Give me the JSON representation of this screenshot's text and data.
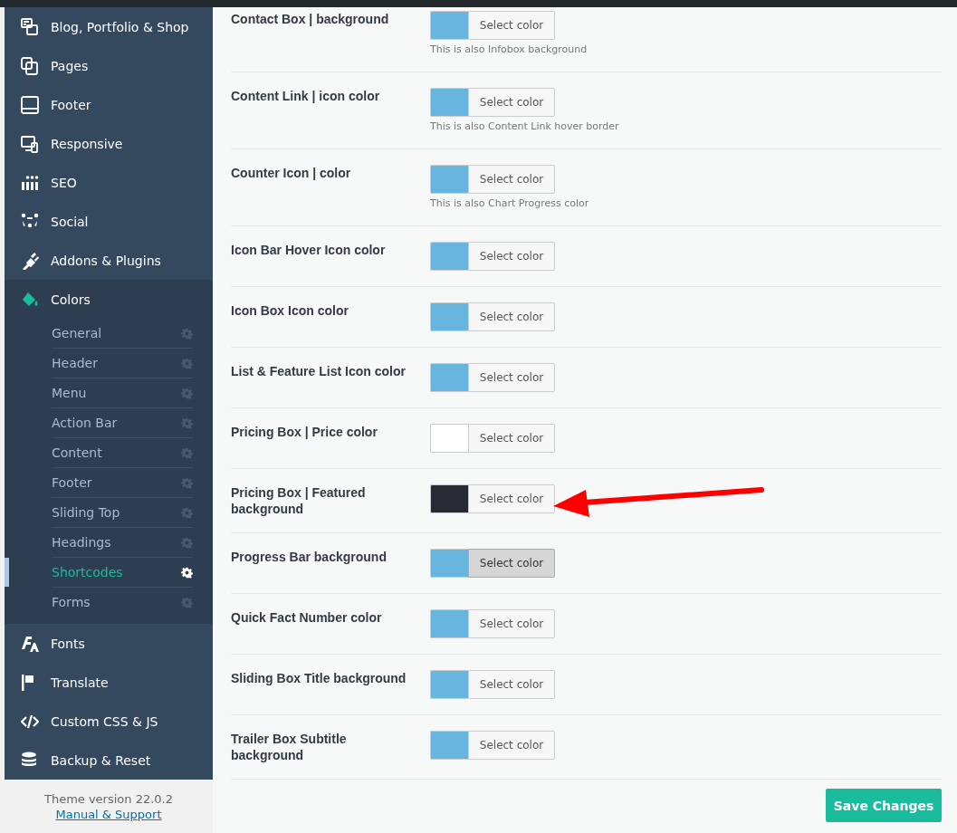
{
  "sidebar": {
    "items": [
      {
        "label": "Blog, Portfolio & Shop",
        "expanded": false
      },
      {
        "label": "Pages",
        "expanded": false
      },
      {
        "label": "Footer",
        "expanded": false
      },
      {
        "label": "Responsive",
        "expanded": false
      },
      {
        "label": "SEO",
        "expanded": false
      },
      {
        "label": "Social",
        "expanded": false
      },
      {
        "label": "Addons & Plugins",
        "expanded": false
      },
      {
        "label": "Colors",
        "expanded": true,
        "children": [
          {
            "label": "General",
            "selected": false
          },
          {
            "label": "Header",
            "selected": false
          },
          {
            "label": "Menu",
            "selected": false
          },
          {
            "label": "Action Bar",
            "selected": false
          },
          {
            "label": "Content",
            "selected": false
          },
          {
            "label": "Footer",
            "selected": false
          },
          {
            "label": "Sliding Top",
            "selected": false
          },
          {
            "label": "Headings",
            "selected": false
          },
          {
            "label": "Shortcodes",
            "selected": true
          },
          {
            "label": "Forms",
            "selected": false
          }
        ]
      },
      {
        "label": "Fonts",
        "expanded": false
      },
      {
        "label": "Translate",
        "expanded": false
      },
      {
        "label": "Custom CSS & JS",
        "expanded": false
      },
      {
        "label": "Backup & Reset",
        "expanded": false
      }
    ],
    "version": "Theme version 22.0.2",
    "support_link": "Manual & Support"
  },
  "settings": [
    {
      "label": "Contact Box | background",
      "color": "#68b5e0",
      "button": "Select color",
      "hint": "This is also Infobox background",
      "hovered": false
    },
    {
      "label": "Content Link | icon color",
      "color": "#68b5e0",
      "button": "Select color",
      "hint": "This is also Content Link hover border",
      "hovered": false
    },
    {
      "label": "Counter Icon | color",
      "color": "#68b5e0",
      "button": "Select color",
      "hint": "This is also Chart Progress color",
      "hovered": false
    },
    {
      "label": "Icon Bar Hover Icon color",
      "color": "#68b5e0",
      "button": "Select color",
      "hovered": false
    },
    {
      "label": "Icon Box Icon color",
      "color": "#68b5e0",
      "button": "Select color",
      "hovered": false
    },
    {
      "label": "List & Feature List Icon color",
      "color": "#68b5e0",
      "button": "Select color",
      "hovered": false
    },
    {
      "label": "Pricing Box | Price color",
      "color": "#ffffff",
      "button": "Select color",
      "hovered": false
    },
    {
      "label": "Pricing Box | Featured background",
      "color": "#272a33",
      "button": "Select color",
      "hovered": false
    },
    {
      "label": "Progress Bar background",
      "color": "#68b5e0",
      "button": "Select color",
      "hovered": true
    },
    {
      "label": "Quick Fact Number color",
      "color": "#68b5e0",
      "button": "Select color",
      "hovered": false
    },
    {
      "label": "Sliding Box Title background",
      "color": "#68b5e0",
      "button": "Select color",
      "hovered": false
    },
    {
      "label": "Trailer Box Subtitle background",
      "color": "#68b5e0",
      "button": "Select color",
      "hovered": false
    }
  ],
  "save_button": "Save Changes"
}
